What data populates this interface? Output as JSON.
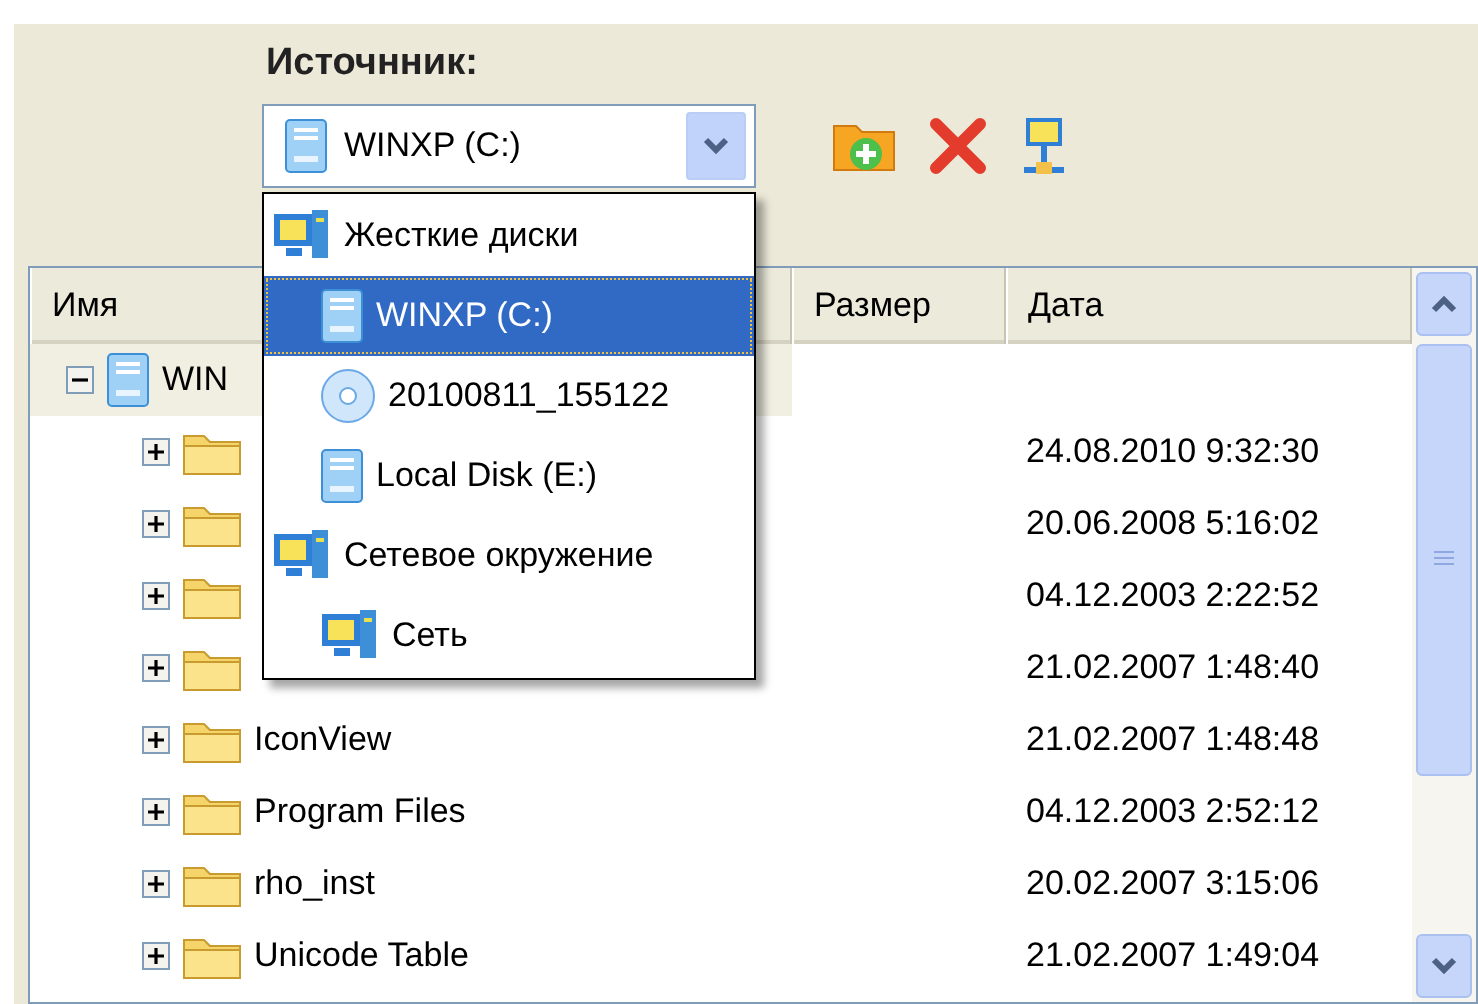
{
  "source_label": "Источнник:",
  "source_combo": {
    "value": "WINXP (C:)",
    "kind": "disk",
    "expanded": true
  },
  "dropdown_items": [
    {
      "label": "Жесткие диски",
      "kind": "computer",
      "selected": false,
      "children": [
        {
          "label": "WINXP (C:)",
          "kind": "disk",
          "selected": true
        },
        {
          "label": "20100811_155122",
          "kind": "cd",
          "selected": false
        },
        {
          "label": "Local Disk (E:)",
          "kind": "disk",
          "selected": false
        }
      ]
    },
    {
      "label": "Сетевое окружение",
      "kind": "computer",
      "selected": false,
      "children": [
        {
          "label": "Сеть",
          "kind": "computer",
          "selected": false
        }
      ]
    }
  ],
  "table": {
    "columns": [
      "Имя",
      "Размер",
      "Дата"
    ],
    "tree": [
      {
        "name": "WIN",
        "kind": "disk",
        "expanded": true,
        "selected": true,
        "children": [
          {
            "kind": "folder",
            "expanded": false,
            "selected": false,
            "date": "24.08.2010 9:32:30"
          },
          {
            "kind": "folder",
            "expanded": false,
            "selected": false,
            "date": "20.06.2008 5:16:02"
          },
          {
            "kind": "folder",
            "expanded": false,
            "selected": false,
            "date": "04.12.2003 2:22:52"
          },
          {
            "kind": "folder",
            "expanded": false,
            "selected": false,
            "date": "21.02.2007 1:48:40"
          },
          {
            "name": "IconView",
            "kind": "folder",
            "expanded": false,
            "selected": false,
            "date": "21.02.2007 1:48:48"
          },
          {
            "name": "Program Files",
            "kind": "folder",
            "expanded": false,
            "selected": false,
            "date": "04.12.2003 2:52:12"
          },
          {
            "name": "rho_inst",
            "kind": "folder",
            "expanded": false,
            "selected": false,
            "date": "20.02.2007 3:15:06"
          },
          {
            "name": "Unicode Table",
            "kind": "folder",
            "expanded": false,
            "selected": false,
            "date": "21.02.2007 1:49:04"
          }
        ]
      }
    ]
  }
}
